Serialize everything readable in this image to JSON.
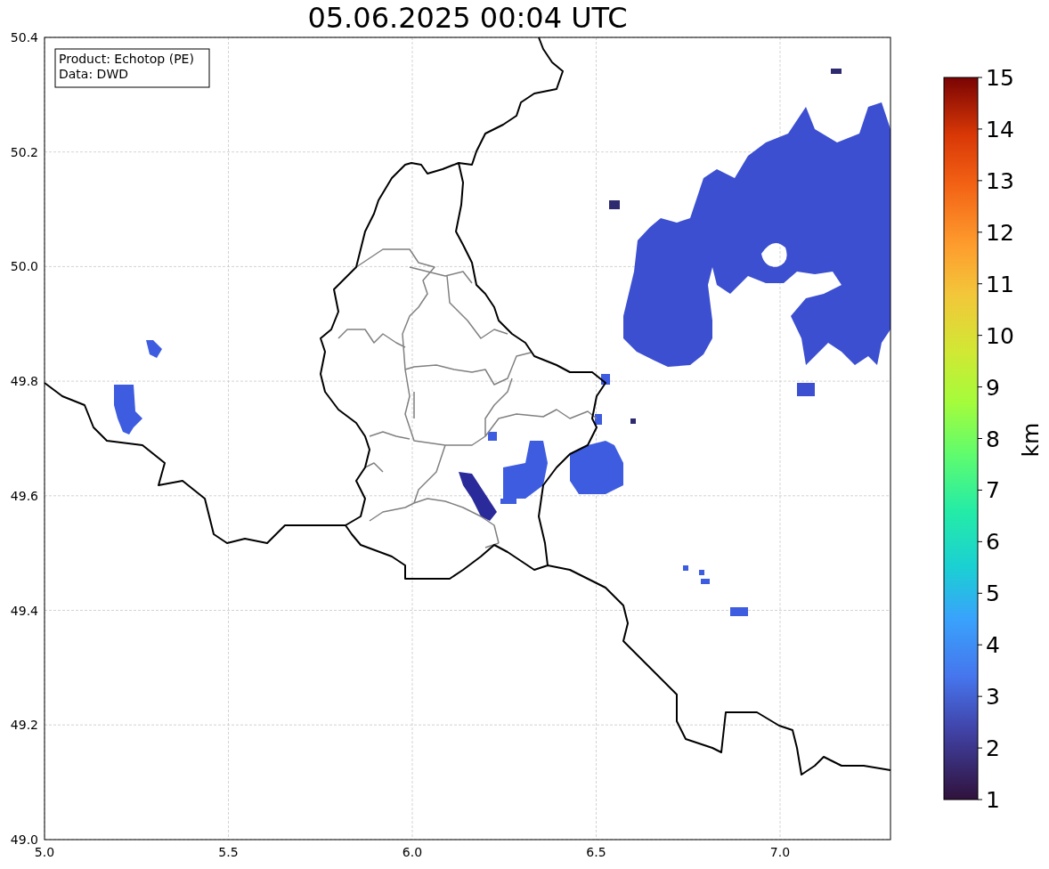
{
  "title": "05.06.2025 00:04 UTC",
  "info_box": [
    "Product: Echotop (PE)",
    "Data: DWD"
  ],
  "x_ticks": [
    "5.0",
    "5.5",
    "6.0",
    "6.5",
    "7.0"
  ],
  "y_ticks": [
    "50.4",
    "50.2",
    "50.0",
    "49.8",
    "49.6",
    "49.4",
    "49.2",
    "49.0"
  ],
  "colorbar": {
    "ticks": [
      "15",
      "14",
      "13",
      "12",
      "11",
      "10",
      "9",
      "8",
      "7",
      "6",
      "5",
      "4",
      "3",
      "2",
      "1"
    ],
    "label": "km"
  }
}
